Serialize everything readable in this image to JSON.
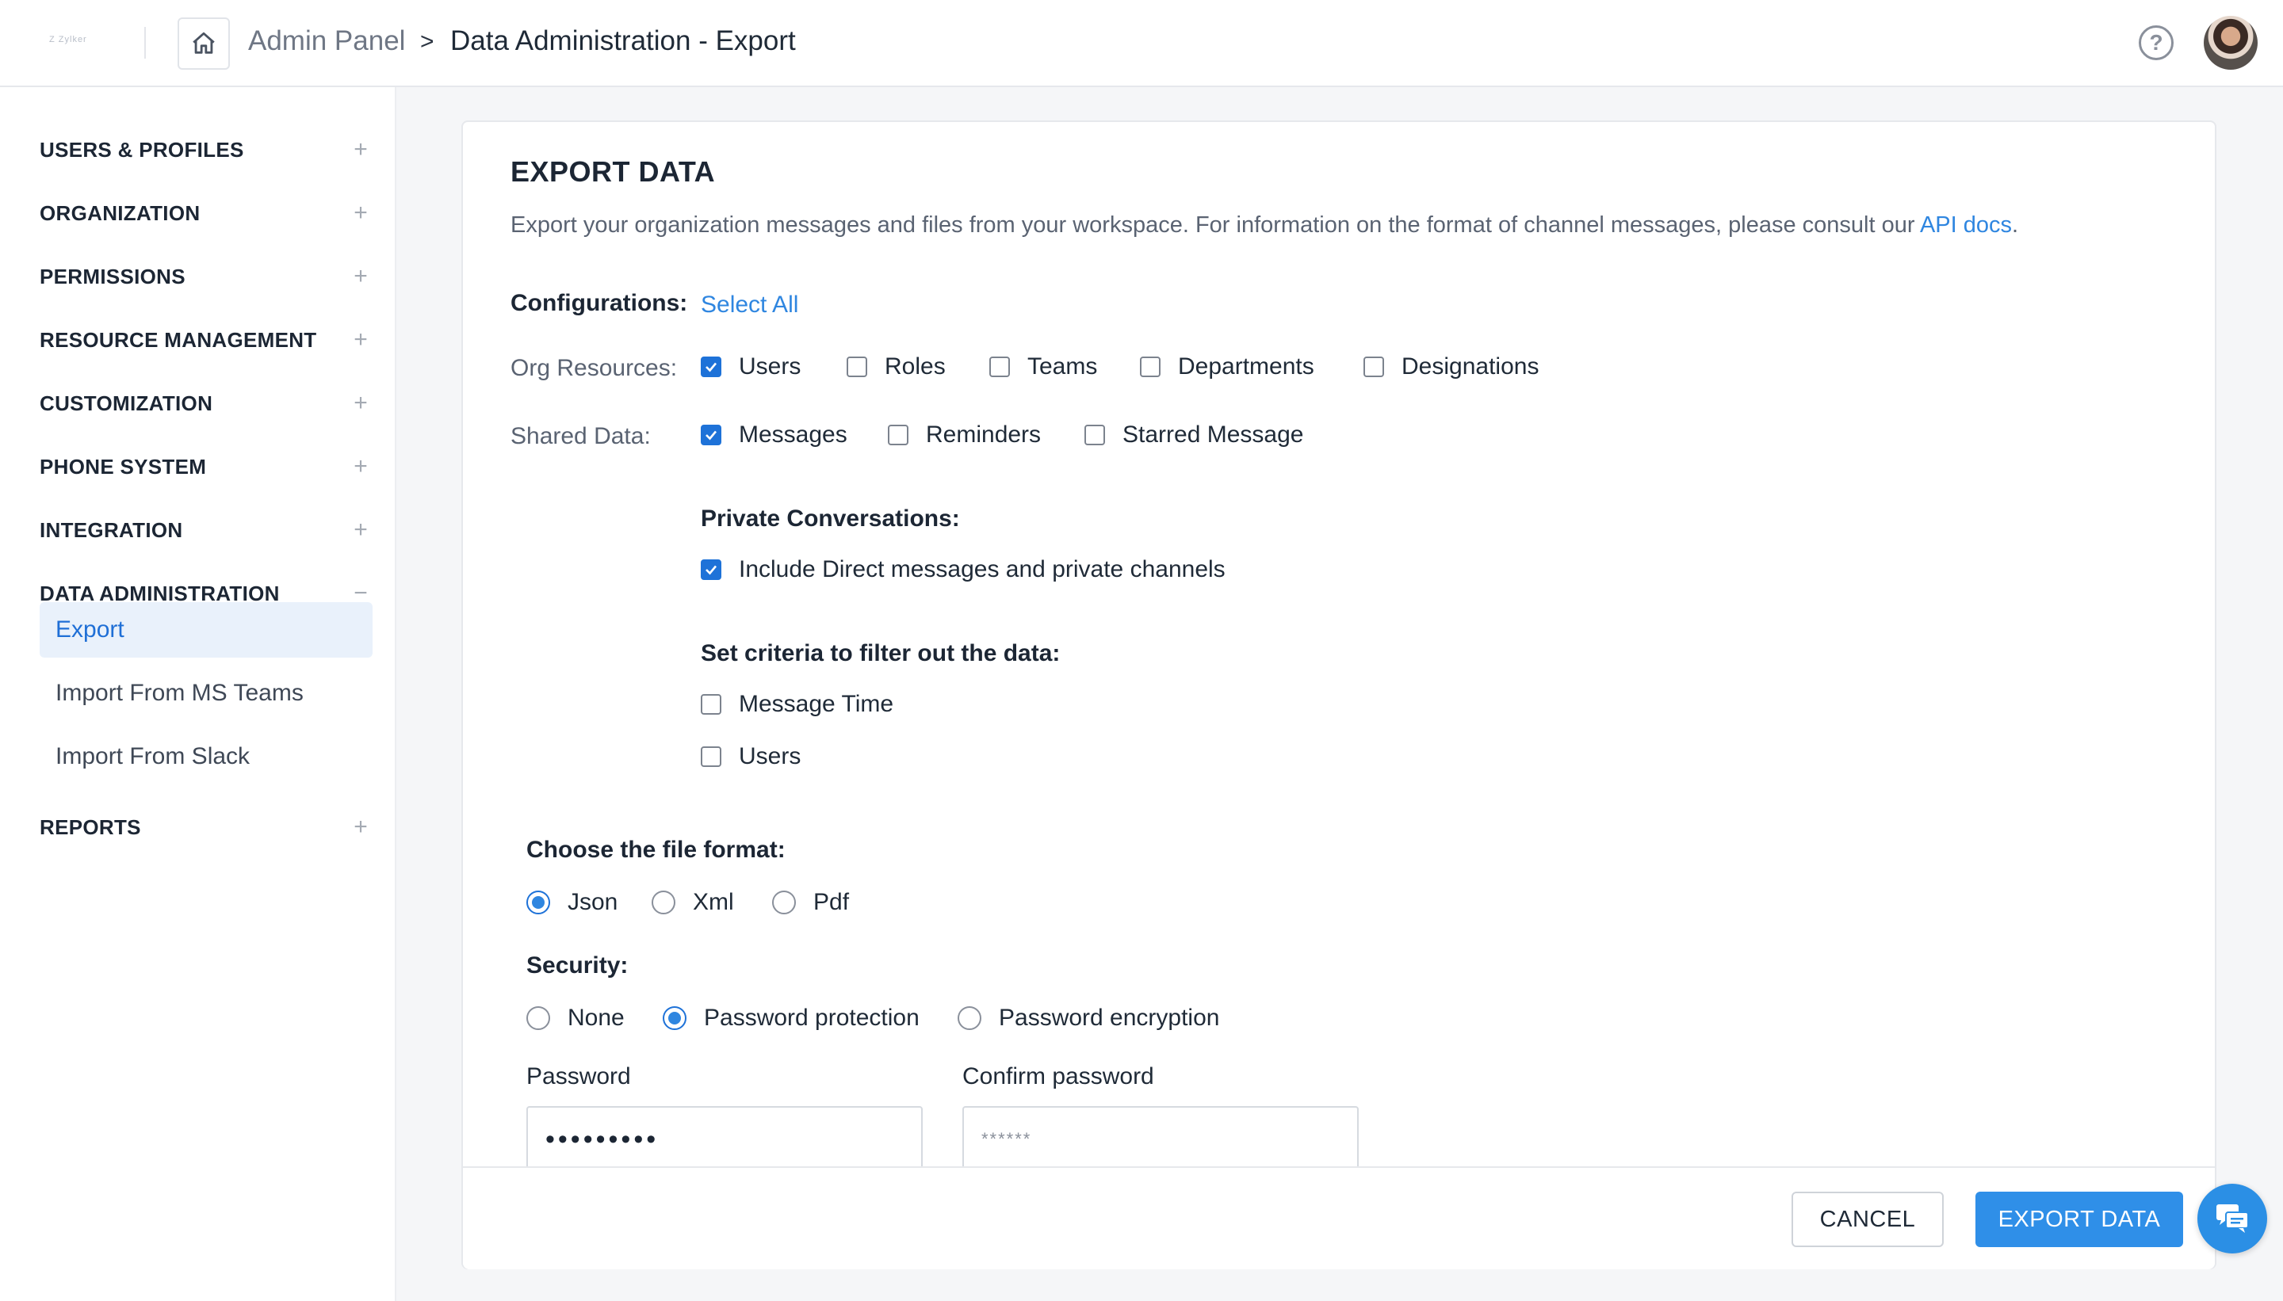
{
  "app": {
    "logo_text": "Z Zylker"
  },
  "header": {
    "breadcrumb_root": "Admin Panel",
    "breadcrumb_sep": ">",
    "breadcrumb_page": "Data Administration - Export",
    "help_symbol": "?"
  },
  "sidebar": {
    "sections": [
      {
        "label": "USERS & PROFILES",
        "toggle": "+"
      },
      {
        "label": "ORGANIZATION",
        "toggle": "+"
      },
      {
        "label": "PERMISSIONS",
        "toggle": "+"
      },
      {
        "label": "RESOURCE MANAGEMENT",
        "toggle": "+"
      },
      {
        "label": "CUSTOMIZATION",
        "toggle": "+"
      },
      {
        "label": "PHONE SYSTEM",
        "toggle": "+"
      },
      {
        "label": "INTEGRATION",
        "toggle": "+"
      },
      {
        "label": "DATA ADMINISTRATION",
        "toggle": "−"
      },
      {
        "label": "REPORTS",
        "toggle": "+"
      }
    ],
    "data_admin_items": [
      {
        "label": "Export",
        "active": true
      },
      {
        "label": "Import From MS Teams",
        "active": false
      },
      {
        "label": "Import From Slack",
        "active": false
      }
    ]
  },
  "main": {
    "title": "EXPORT DATA",
    "description": "Export your organization messages and files from your workspace. For information on the format of channel messages, please consult our ",
    "description_link": "API docs",
    "description_end": ".",
    "configurations_label": "Configurations:",
    "select_all": "Select All",
    "org_resources": {
      "label": "Org Resources:",
      "options": [
        {
          "label": "Users",
          "checked": true
        },
        {
          "label": "Roles",
          "checked": false
        },
        {
          "label": "Teams",
          "checked": false
        },
        {
          "label": "Departments",
          "checked": false
        },
        {
          "label": "Designations",
          "checked": false
        }
      ]
    },
    "shared_data": {
      "label": "Shared Data:",
      "options": [
        {
          "label": "Messages",
          "checked": true
        },
        {
          "label": "Reminders",
          "checked": false
        },
        {
          "label": "Starred Message",
          "checked": false
        }
      ]
    },
    "private_conversations": {
      "heading": "Private Conversations:",
      "option": {
        "label": "Include Direct messages and private channels",
        "checked": true
      }
    },
    "filter_criteria": {
      "heading": "Set criteria to filter out the data:",
      "options": [
        {
          "label": "Message Time",
          "checked": false
        },
        {
          "label": "Users",
          "checked": false
        }
      ]
    },
    "file_format": {
      "heading": "Choose the file format:",
      "options": [
        "Json",
        "Xml",
        "Pdf"
      ],
      "selected": "Json"
    },
    "security": {
      "heading": "Security:",
      "options": [
        "None",
        "Password protection",
        "Password encryption"
      ],
      "selected": "Password protection"
    },
    "password": {
      "label": "Password",
      "value": "•••••••••"
    },
    "confirm_password": {
      "label": "Confirm password",
      "placeholder": "******"
    },
    "buttons": {
      "cancel": "CANCEL",
      "export": "EXPORT DATA"
    }
  },
  "colors": {
    "accent": "#2f86e0",
    "checkbox_checked": "#1e72d8",
    "active_nav_bg": "#e9f1fb"
  }
}
